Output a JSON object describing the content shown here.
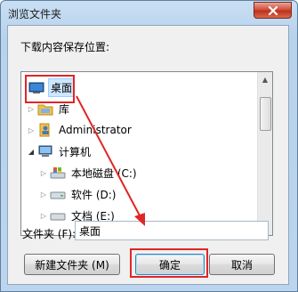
{
  "window": {
    "title": "浏览文件夹"
  },
  "dialog": {
    "prompt": "下载内容保存位置:",
    "tree": {
      "items": [
        {
          "label": "桌面",
          "icon": "desktop-icon",
          "selected": true
        },
        {
          "label": "库",
          "icon": "library-icon"
        },
        {
          "label": "Administrator",
          "icon": "user-folder-icon"
        },
        {
          "label": "计算机",
          "icon": "computer-icon"
        },
        {
          "label": "本地磁盘 (C:)",
          "icon": "system-drive-icon"
        },
        {
          "label": "软件 (D:)",
          "icon": "drive-icon"
        },
        {
          "label": "文档 (E:)",
          "icon": "drive-icon"
        }
      ]
    },
    "folder_label": "文件夹 (F):",
    "folder_value": "桌面",
    "buttons": {
      "new_folder": "新建文件夹 (M)",
      "ok": "确定",
      "cancel": "取消"
    }
  },
  "colors": {
    "annotation": "#e02626",
    "selection": "#cde8ff"
  }
}
